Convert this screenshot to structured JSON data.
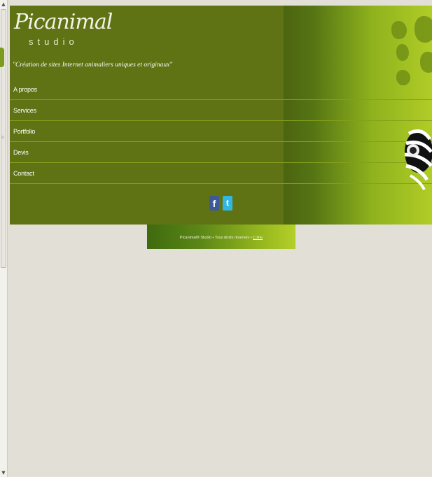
{
  "logo": {
    "name": "Picanimal",
    "sub": "studio"
  },
  "tagline": "\"Création de sites Internet animaliers uniques et originaux\"",
  "nav": [
    {
      "label": "A propos"
    },
    {
      "label": "Services"
    },
    {
      "label": "Portfolio"
    },
    {
      "label": "Devis"
    },
    {
      "label": "Contact"
    }
  ],
  "social": {
    "facebook": "f",
    "twitter": "t"
  },
  "footer": {
    "text": "Picanimal® Studio • Tous droits réservés •",
    "link": "C.line"
  },
  "colors": {
    "header_bg": "#5f7314",
    "accent_green": "#b0cc26",
    "page_bg": "#e2dfd6"
  },
  "icons": [
    "facebook-icon",
    "twitter-icon",
    "chevron-right-icon",
    "lemur-mascot"
  ]
}
